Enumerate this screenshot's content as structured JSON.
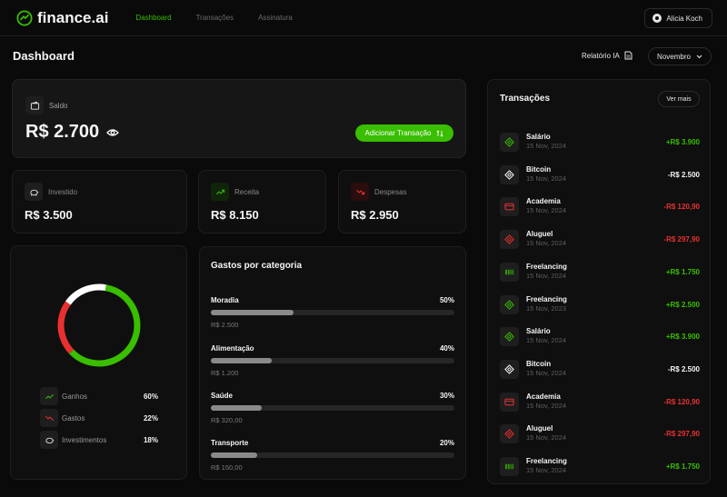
{
  "app": {
    "logo_text": "finance.ai",
    "colors": {
      "accent": "#39be00",
      "danger": "#e93030",
      "neutral": "#ffffff",
      "background": "#0a0a0a"
    }
  },
  "nav": {
    "links": [
      {
        "label": "Dashboard",
        "active": true
      },
      {
        "label": "Transações",
        "active": false
      },
      {
        "label": "Assinatura",
        "active": false
      }
    ],
    "user_name": "Alicia Koch"
  },
  "header": {
    "title": "Dashboard",
    "report_label": "Relatório IA",
    "month_selected": "Novembro"
  },
  "balance": {
    "label": "Saldo",
    "value": "R$ 2.700",
    "add_button_label": "Adicionar Transação"
  },
  "stats": [
    {
      "label": "Investido",
      "value": "R$ 3.500",
      "icon": "piggy-bank-icon"
    },
    {
      "label": "Receita",
      "value": "R$ 8.150",
      "icon": "trending-up-icon"
    },
    {
      "label": "Despesas",
      "value": "R$ 2.950",
      "icon": "trending-down-icon"
    }
  ],
  "donut": {
    "segments": [
      {
        "label": "Ganhos",
        "percent": 60,
        "color": "#39be00"
      },
      {
        "label": "Gastos",
        "percent": 22,
        "color": "#e93030"
      },
      {
        "label": "Investimentos",
        "percent": 18,
        "color": "#ffffff"
      }
    ],
    "legend": [
      {
        "label": "Ganhos",
        "pct": "60%",
        "icon": "trending-up-icon"
      },
      {
        "label": "Gastos",
        "pct": "22%",
        "icon": "trending-down-icon"
      },
      {
        "label": "Investimentos",
        "pct": "18%",
        "icon": "piggy-bank-icon"
      }
    ]
  },
  "categories": {
    "title": "Gastos por categoria",
    "items": [
      {
        "name": "Moradia",
        "pct": "50%",
        "amount": "R$ 2.500",
        "fill": 0.34
      },
      {
        "name": "Alimentação",
        "pct": "40%",
        "amount": "R$ 1.200",
        "fill": 0.25
      },
      {
        "name": "Saúde",
        "pct": "30%",
        "amount": "R$ 320,00",
        "fill": 0.21
      },
      {
        "name": "Transporte",
        "pct": "20%",
        "amount": "R$ 150,00",
        "fill": 0.19
      }
    ]
  },
  "transactions": {
    "title": "Transações",
    "view_more": "Ver mais",
    "items": [
      {
        "name": "Salário",
        "date": "15 Nov, 2024",
        "amount": "+R$ 3.900",
        "kind": "pos",
        "icon": "pix-icon"
      },
      {
        "name": "Bitcoin",
        "date": "15 Nov, 2024",
        "amount": "-R$ 2.500",
        "kind": "neu",
        "icon": "pix-icon"
      },
      {
        "name": "Academia",
        "date": "15 Nov, 2024",
        "amount": "-R$ 120,90",
        "kind": "neg",
        "icon": "credit-card-icon"
      },
      {
        "name": "Aluguel",
        "date": "15 Nov, 2024",
        "amount": "-R$ 297,90",
        "kind": "neg",
        "icon": "pix-icon"
      },
      {
        "name": "Freelancing",
        "date": "15 Nov, 2024",
        "amount": "+R$ 1.750",
        "kind": "pos",
        "icon": "barcode-icon"
      },
      {
        "name": "Freelancing",
        "date": "15 Nov, 2023",
        "amount": "+R$ 2.500",
        "kind": "pos",
        "icon": "pix-icon"
      },
      {
        "name": "Salário",
        "date": "15 Nov, 2024",
        "amount": "+R$ 3.900",
        "kind": "pos",
        "icon": "pix-icon"
      },
      {
        "name": "Bitcoin",
        "date": "15 Nov, 2024",
        "amount": "-R$ 2.500",
        "kind": "neu",
        "icon": "pix-icon"
      },
      {
        "name": "Academia",
        "date": "15 Nov, 2024",
        "amount": "-R$ 120,90",
        "kind": "neg",
        "icon": "credit-card-icon"
      },
      {
        "name": "Aluguel",
        "date": "15 Nov, 2024",
        "amount": "-R$ 297,90",
        "kind": "neg",
        "icon": "pix-icon"
      },
      {
        "name": "Freelancing",
        "date": "15 Nov, 2024",
        "amount": "+R$ 1.750",
        "kind": "pos",
        "icon": "barcode-icon"
      }
    ]
  }
}
